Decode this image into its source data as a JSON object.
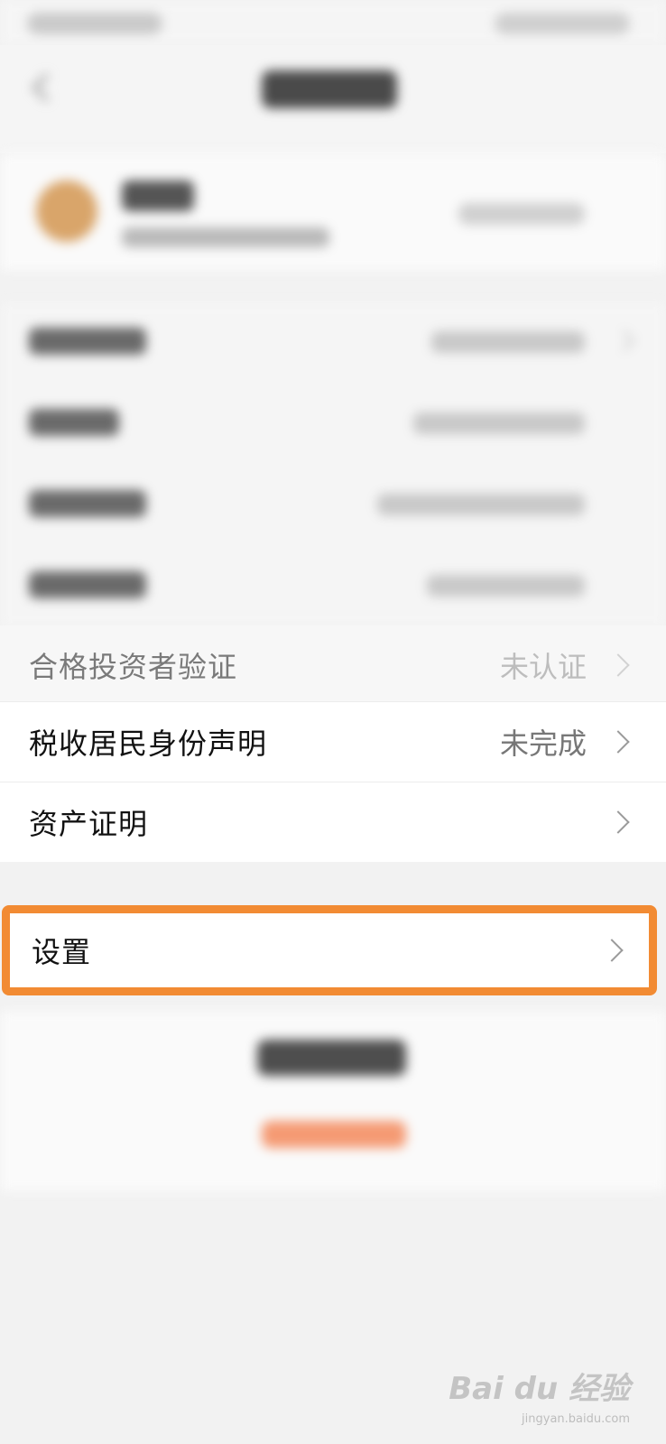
{
  "rows": {
    "investor": {
      "label": "合格投资者验证",
      "value": "未认证"
    },
    "tax": {
      "label": "税收居民身份声明",
      "value": "未完成"
    },
    "assets": {
      "label": "资产证明"
    },
    "settings": {
      "label": "设置"
    }
  },
  "colors": {
    "highlight": "#f28b33",
    "page_bg": "#f2f2f2"
  },
  "icons": [
    "back-arrow-icon",
    "chevron-right-icon"
  ],
  "watermark": {
    "brand": "Bai du 经验",
    "url": "jingyan.baidu.com"
  }
}
